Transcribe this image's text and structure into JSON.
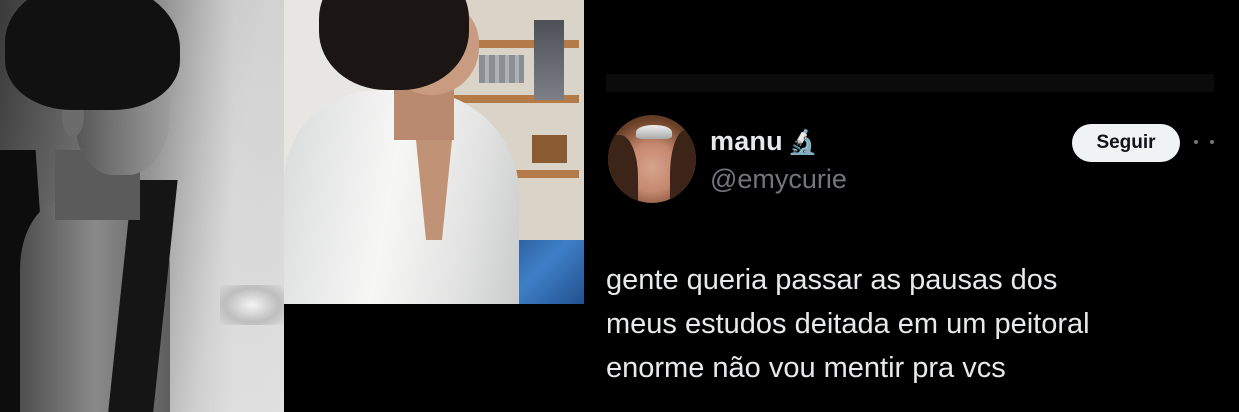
{
  "tweet": {
    "display_name": "manu",
    "name_emoji": "🔬",
    "handle": "@emycurie",
    "follow_label": "Seguir",
    "text": "gente queria passar as pausas dos\nmeus estudos deitada em um peitoral\nenorme não vou mentir pra vcs"
  },
  "icons": {
    "microscope": "microscope-icon",
    "more": "more-options-icon"
  },
  "colors": {
    "background": "#000000",
    "text_primary": "#e7e9ea",
    "text_secondary": "#71767b",
    "follow_button_bg": "#eff3f4",
    "follow_button_text": "#0f1419"
  }
}
